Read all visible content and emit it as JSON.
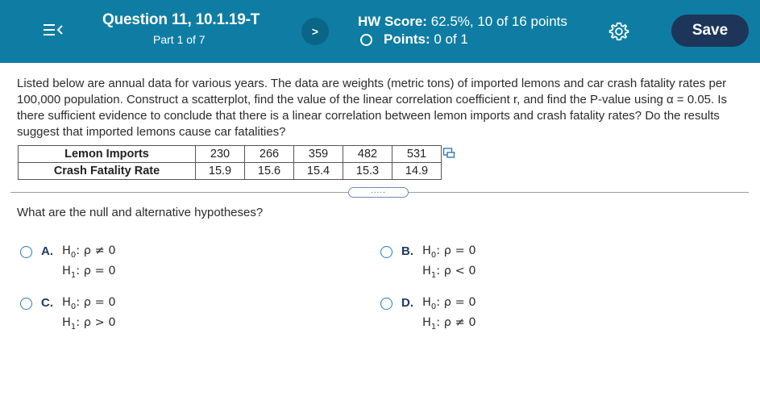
{
  "header": {
    "question_title": "Question 11, 10.1.19-T",
    "part": "Part 1 of 7",
    "hw_score_label": "HW Score:",
    "hw_score_value": "62.5%, 10 of 16 points",
    "points_label": "Points:",
    "points_value": "0 of 1",
    "save_label": "Save",
    "next_glyph": ">",
    "colors": {
      "bar": "#0f7da3",
      "save": "#1d3559"
    }
  },
  "question": {
    "text": "Listed below are annual data for various years. The data are weights (metric tons) of imported lemons and car crash fatality rates per 100,000 population. Construct a scatterplot, find the value of the linear correlation coefficient r, and find the P-value using α = 0.05. Is there sufficient evidence to conclude that there is a linear correlation between lemon imports and crash fatality rates? Do the results suggest that imported lemons cause car fatalities?"
  },
  "data_table": {
    "row1_label": "Lemon Imports",
    "row1_values": [
      "230",
      "266",
      "359",
      "482",
      "531"
    ],
    "row2_label": "Crash Fatality Rate",
    "row2_values": [
      "15.9",
      "15.6",
      "15.4",
      "15.3",
      "14.9"
    ]
  },
  "more_button": ".....",
  "prompt": "What are the null and alternative hypotheses?",
  "options": [
    {
      "letter": "A.",
      "h0": "≠ 0",
      "h1": "= 0"
    },
    {
      "letter": "B.",
      "h0": "= 0",
      "h1": "< 0"
    },
    {
      "letter": "C.",
      "h0": "= 0",
      "h1": "> 0"
    },
    {
      "letter": "D.",
      "h0": "= 0",
      "h1": "≠ 0"
    }
  ],
  "hyp_prefix": {
    "h0": "H",
    "h0_sub": "0",
    "h1": "H",
    "h1_sub": "1",
    "rho": ": ρ "
  },
  "icons": [
    "menu-icon",
    "chevron-right-icon",
    "circle-outline-icon",
    "gear-icon",
    "copy-icon"
  ]
}
